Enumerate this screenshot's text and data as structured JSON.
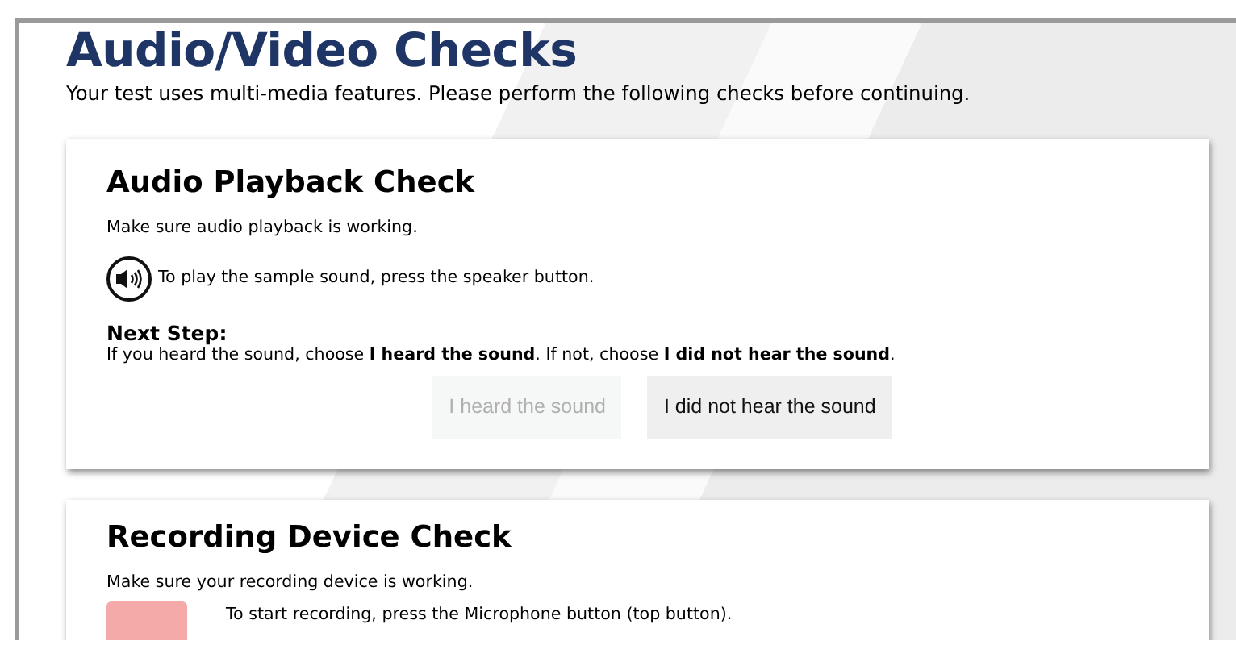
{
  "page": {
    "title": "Audio/Video Checks",
    "intro": "Your test uses multi-media features. Please perform the following checks before continuing."
  },
  "audio_check": {
    "title": "Audio Playback Check",
    "description": "Make sure audio playback is working.",
    "instruction": "To play the sample sound, press the speaker button.",
    "next_step_label": "Next Step:",
    "next_step_text": "If you heard the sound, choose **I heard the sound**. If not, choose **I did not hear the sound**.",
    "buttons": [
      {
        "label": "I heard the sound",
        "disabled": true
      },
      {
        "label": "I did not hear the sound",
        "disabled": false
      }
    ]
  },
  "recording_check": {
    "title": "Recording Device Check",
    "description": "Make sure your recording device is working.",
    "instruction": "To start recording, press the Microphone button (top button)."
  }
}
